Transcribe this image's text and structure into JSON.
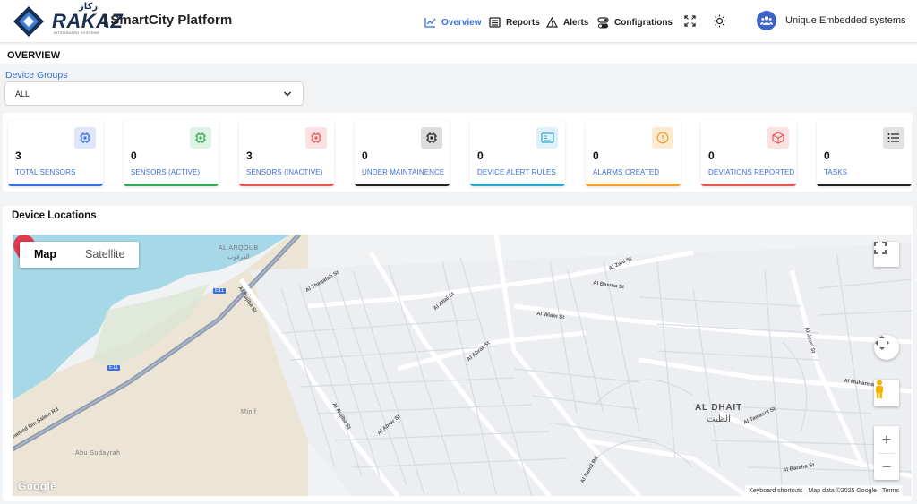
{
  "brand": {
    "logo_text": "RAKAZ",
    "logo_arabic": "ركاز",
    "logo_sub": "INTEGRATED SYSTEMS",
    "app_title": "| SmartCity Platform"
  },
  "nav": {
    "overview": "Overview",
    "reports": "Reports",
    "alerts": "Alerts",
    "configurations": "Configrations"
  },
  "user": {
    "name": "Unique Embedded systems"
  },
  "overview": {
    "title": "OVERVIEW",
    "device_groups_label": "Device Groups",
    "device_groups_value": "ALL"
  },
  "stats": [
    {
      "value": "3",
      "label": "TOTAL SENSORS",
      "icon": "chip-icon",
      "color": "#3b6fd8",
      "bg": "#dfe6fb"
    },
    {
      "value": "0",
      "label": "SENSORS (ACTIVE)",
      "icon": "chip-icon",
      "color": "#3aa55c",
      "bg": "#ddf3e3"
    },
    {
      "value": "3",
      "label": "SENSORS (INACTIVE)",
      "icon": "chip-icon",
      "color": "#e05a5a",
      "bg": "#fbe1e1"
    },
    {
      "value": "0",
      "label": "UNDER MAINTAINENCE",
      "icon": "chip-icon",
      "color": "#222222",
      "bg": "#dcdcdc"
    },
    {
      "value": "0",
      "label": "DEVICE ALERT RULES",
      "icon": "card-icon",
      "color": "#38a6c9",
      "bg": "#dff1f8"
    },
    {
      "value": "0",
      "label": "ALARMS CREATED",
      "icon": "warning-circle-icon",
      "color": "#f0a232",
      "bg": "#fcebd3"
    },
    {
      "value": "0",
      "label": "DEVIATIONS REPORTED",
      "icon": "box-icon",
      "color": "#e05a5a",
      "bg": "#fbe1e1"
    },
    {
      "value": "0",
      "label": "TASKS",
      "icon": "list-icon",
      "color": "#222222",
      "bg": "#e2e2e2"
    }
  ],
  "locations": {
    "title": "Device Locations",
    "map_type_map": "Map",
    "map_type_satellite": "Satellite",
    "google": "Google",
    "attribution": {
      "shortcuts": "Keyboard shortcuts",
      "data": "Map data ©2025 Google",
      "terms": "Terms"
    },
    "labels": {
      "al_arqoub": "AL ARQOUB",
      "al_arqoub_ar": "العرقوب",
      "al_dhait": "AL DHAIT",
      "al_dhait_ar": "الظيت",
      "minif": "Minif",
      "abu_sudayrah": "Abu Sudayrah",
      "bin_salem": "hamed Bin Salem Rd",
      "rujiba": "Al Rujiba St",
      "thaqafah": "Al Thaqafah St",
      "muhannad": "Al Muhannad Rd",
      "basma": "Al Basma St",
      "wiam": "Al Wiam St",
      "zahi": "Al Zahi St",
      "abrar": "Al Abrar St",
      "jouri": "Al Jouri St",
      "tawasol": "Al Tawasol St",
      "baraha": "Al Baraha St",
      "samil": "Al Samil Rd",
      "atlal": "Al Atlal St",
      "e11": "E11"
    }
  }
}
